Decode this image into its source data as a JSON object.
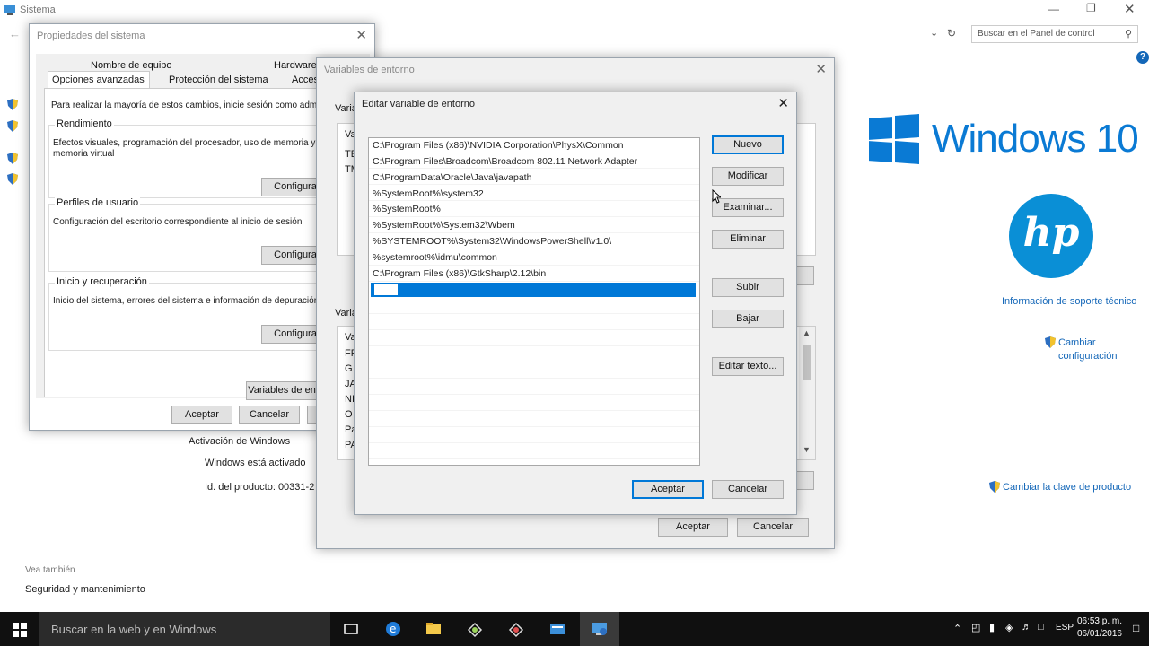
{
  "main": {
    "title": "Sistema",
    "search_placeholder": "Buscar en el Panel de control",
    "windows_text": "Windows 10",
    "hp_text": "hp",
    "support_link": "Información de soporte técnico",
    "change_config_1": "Cambiar",
    "change_config_2": "configuración",
    "activation_header": "Activación de Windows",
    "activation_status": "Windows está activado",
    "product_id": "Id. del producto: 00331-2",
    "change_key_link": "Cambiar la clave de producto",
    "see_also": "Vea también",
    "security_link": "Seguridad y mantenimiento"
  },
  "props": {
    "title": "Propiedades del sistema",
    "tabs_top": [
      "Nombre de equipo",
      "Hardware"
    ],
    "tabs_bottom": [
      "Opciones avanzadas",
      "Protección del sistema",
      "Acces"
    ],
    "intro": "Para realizar la mayoría de estos cambios, inicie sesión como admi",
    "perf_label": "Rendimiento",
    "perf_desc_1": "Efectos visuales, programación del procesador, uso de memoria y",
    "perf_desc_2": "memoria virtual",
    "config_btn": "Configura",
    "profiles_label": "Perfiles de usuario",
    "profiles_desc": "Configuración del escritorio correspondiente al inicio de sesión",
    "startup_label": "Inicio y recuperación",
    "startup_desc": "Inicio del sistema, errores del sistema e información de depuración",
    "env_btn": "Variables de en",
    "accept": "Aceptar",
    "cancel": "Cancelar"
  },
  "envvars": {
    "title": "Variables de entorno",
    "user_label": "Varia",
    "col_va": "Va",
    "te": "TE",
    "tm": "TM",
    "sys_label": "Varia",
    "sys_rows": [
      "Va",
      "FP",
      "G",
      "JA",
      "NI",
      "O",
      "Pa",
      "PA"
    ],
    "accept": "Aceptar",
    "cancel": "Cancelar"
  },
  "edit": {
    "title": "Editar variable de entorno",
    "paths": [
      "C:\\Program Files (x86)\\NVIDIA Corporation\\PhysX\\Common",
      "C:\\Program Files\\Broadcom\\Broadcom 802.11 Network Adapter",
      "C:\\ProgramData\\Oracle\\Java\\javapath",
      "%SystemRoot%\\system32",
      "%SystemRoot%",
      "%SystemRoot%\\System32\\Wbem",
      "%SYSTEMROOT%\\System32\\WindowsPowerShell\\v1.0\\",
      "%systemroot%\\idmu\\common",
      "C:\\Program Files (x86)\\GtkSharp\\2.12\\bin"
    ],
    "new_entry_value": "",
    "btn_new": "Nuevo",
    "btn_edit": "Modificar",
    "btn_browse": "Examinar...",
    "btn_delete": "Eliminar",
    "btn_up": "Subir",
    "btn_down": "Bajar",
    "btn_edit_text": "Editar texto...",
    "accept": "Aceptar",
    "cancel": "Cancelar"
  },
  "taskbar": {
    "search": "Buscar en la web y en Windows",
    "lang": "ESP",
    "time": "06:53 p. m.",
    "date": "06/01/2016",
    "icons": [
      "task-view-icon",
      "edge-icon",
      "file-explorer-icon",
      "app-icon",
      "app2-icon",
      "app3-icon",
      "control-panel-icon"
    ]
  },
  "colors": {
    "accent": "#0078d7",
    "windows_blue": "#0a7ad4",
    "hp_blue": "#0a8fd6",
    "taskbar": "#101010"
  }
}
